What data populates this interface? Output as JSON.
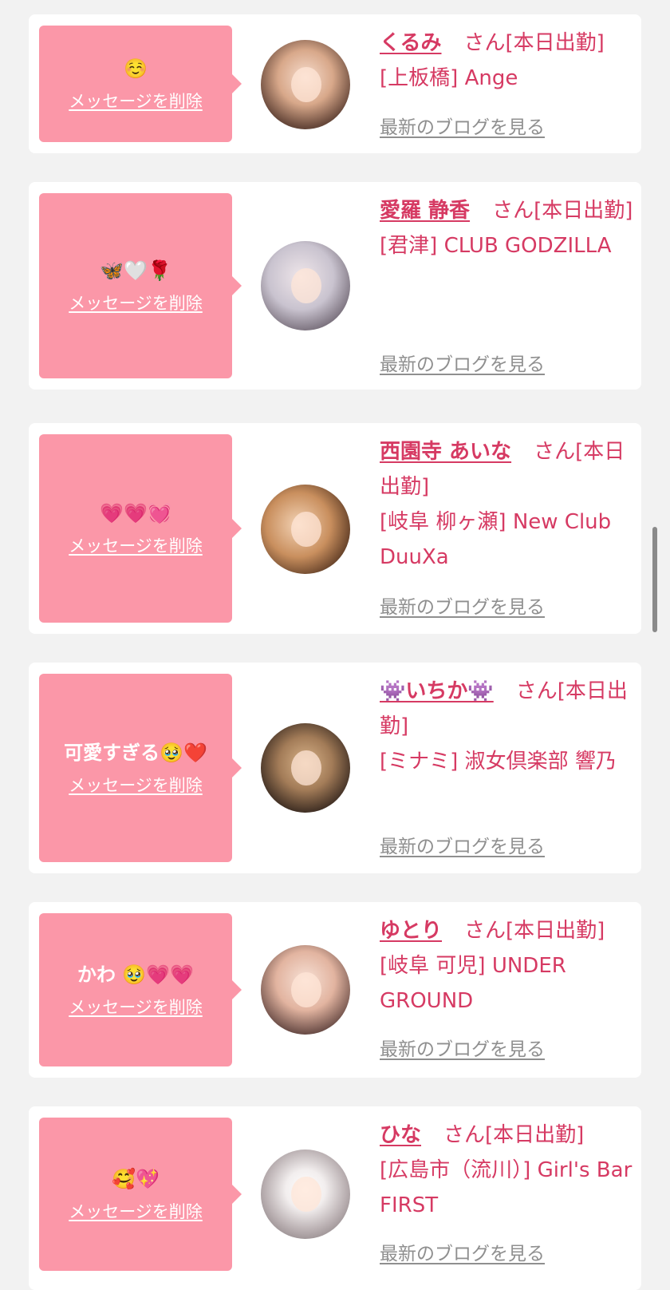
{
  "common": {
    "delete_label": "メッセージを削除",
    "blog_label": "最新のブログを見る",
    "honorific": "さん",
    "brand_color": "#d63a63",
    "bubble_color": "#fb97a8",
    "link_gray": "#8f8f8f"
  },
  "messages": [
    {
      "message": "☺️",
      "girl_name": "くるみ",
      "status": "[本日出勤]",
      "area": "[上板橋]",
      "shop": "Ange",
      "avatar_icon": "profile-photo"
    },
    {
      "message": "🦋🤍🌹",
      "girl_name": "愛羅 静香",
      "status": "[本日出勤]",
      "area": "[君津]",
      "shop": "CLUB GODZILLA",
      "avatar_icon": "profile-photo"
    },
    {
      "message": "💗💗💓",
      "girl_name": "西園寺 あいな",
      "status": "[本日出勤]",
      "area": "[岐阜 柳ヶ瀬]",
      "shop": "New Club DuuXa",
      "avatar_icon": "profile-photo"
    },
    {
      "message": "可愛すぎる🥹❤️",
      "girl_name": "👾いちか👾",
      "status": "[本日出勤]",
      "area": "[ミナミ]",
      "shop": "淑女倶楽部 響乃",
      "avatar_icon": "profile-photo"
    },
    {
      "message": "かわ 🥹💗💗",
      "girl_name": "ゆとり",
      "status": "[本日出勤]",
      "area": "[岐阜 可児]",
      "shop": "UNDER GROUND",
      "avatar_icon": "profile-photo"
    },
    {
      "message": "🥰💖",
      "girl_name": "ひな",
      "status": "[本日出勤]",
      "area": "[広島市（流川）]",
      "shop": "Girl's Bar FIRST",
      "avatar_icon": "profile-photo"
    }
  ]
}
